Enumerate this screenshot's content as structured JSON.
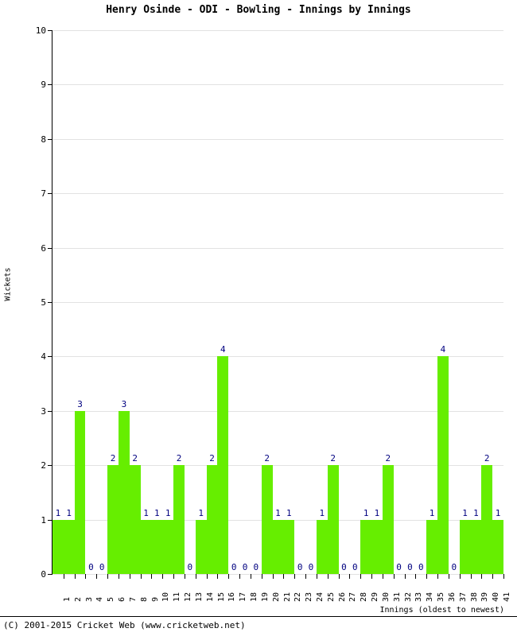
{
  "chart_data": {
    "type": "bar",
    "title": "Henry Osinde - ODI - Bowling - Innings by Innings",
    "xlabel": "Innings (oldest to newest)",
    "ylabel": "Wickets",
    "ylim": [
      0,
      10
    ],
    "ytick_labels": [
      "0",
      "1",
      "2",
      "3",
      "4",
      "5",
      "6",
      "7",
      "8",
      "9",
      "10"
    ],
    "grid": true,
    "legend": "none",
    "bar_color": "#66ee00",
    "value_label_color": "#000080",
    "categories": [
      "1",
      "2",
      "3",
      "4",
      "5",
      "6",
      "7",
      "8",
      "9",
      "10",
      "11",
      "12",
      "13",
      "14",
      "15",
      "16",
      "17",
      "18",
      "19",
      "20",
      "21",
      "22",
      "23",
      "24",
      "25",
      "26",
      "27",
      "28",
      "29",
      "30",
      "31",
      "32",
      "33",
      "34",
      "35",
      "36",
      "37",
      "38",
      "39",
      "40",
      "41"
    ],
    "values": [
      1,
      1,
      3,
      0,
      0,
      2,
      3,
      2,
      1,
      1,
      1,
      2,
      0,
      1,
      2,
      4,
      0,
      0,
      0,
      2,
      1,
      1,
      0,
      0,
      1,
      2,
      0,
      0,
      1,
      1,
      2,
      0,
      0,
      0,
      1,
      4,
      0,
      1,
      1,
      2,
      1
    ]
  },
  "footer": {
    "copyright": "(C) 2001-2015 Cricket Web (www.cricketweb.net)"
  }
}
